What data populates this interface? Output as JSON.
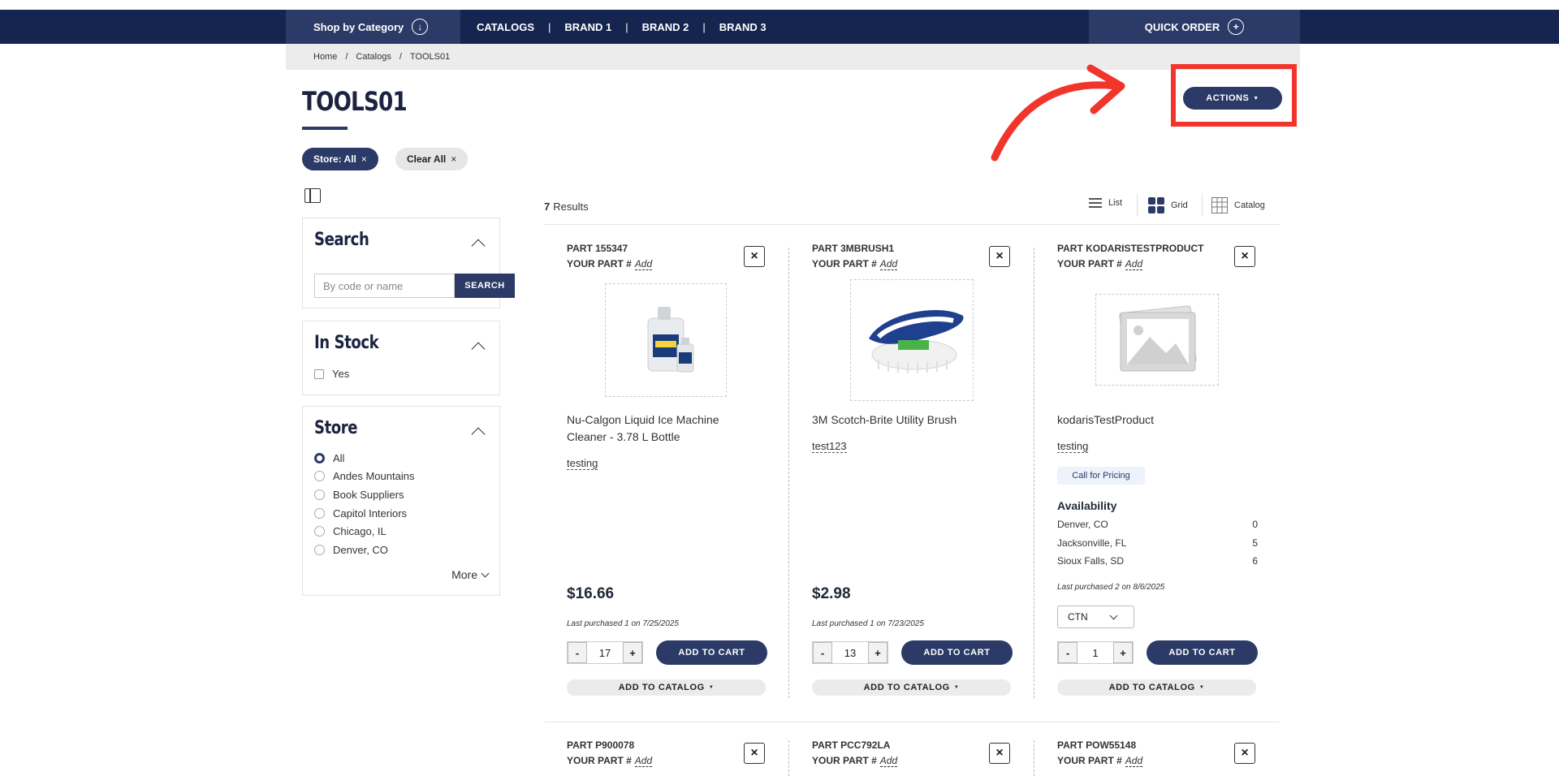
{
  "nav": {
    "shop_by_category": "Shop by Category",
    "links": [
      "CATALOGS",
      "BRAND 1",
      "BRAND 2",
      "BRAND 3"
    ],
    "quick_order": "QUICK ORDER"
  },
  "breadcrumb": [
    "Home",
    "Catalogs",
    "TOOLS01"
  ],
  "page": {
    "title": "TOOLS01",
    "actions_label": "ACTIONS"
  },
  "filters": {
    "store_chip": "Store: All",
    "clear_chip": "Clear All"
  },
  "sidebar": {
    "search": {
      "title": "Search",
      "placeholder": "By code or name",
      "button": "SEARCH"
    },
    "in_stock": {
      "title": "In Stock",
      "option": "Yes"
    },
    "store": {
      "title": "Store",
      "options": [
        "All",
        "Andes Mountains",
        "Book Suppliers",
        "Capitol Interiors",
        "Chicago, IL",
        "Denver, CO"
      ],
      "selected": "All",
      "more": "More"
    }
  },
  "results": {
    "count": "7",
    "label": "Results",
    "views": [
      "List",
      "Grid",
      "Catalog"
    ]
  },
  "common": {
    "your_part": "YOUR PART #",
    "add": "Add",
    "add_to_cart": "ADD TO CART",
    "add_to_catalog": "ADD TO CATALOG"
  },
  "products": [
    {
      "part": "PART 155347",
      "name": "Nu-Calgon Liquid Ice Machine Cleaner - 3.78 L Bottle",
      "tag": "testing",
      "price": "$16.66",
      "last_purchased": "Last purchased 1 on 7/25/2025",
      "qty": "17"
    },
    {
      "part": "PART 3MBRUSH1",
      "name": "3M Scotch-Brite Utility Brush",
      "tag": "test123",
      "price": "$2.98",
      "last_purchased": "Last purchased 1 on 7/23/2025",
      "qty": "13"
    },
    {
      "part": "PART KODARISTESTPRODUCT",
      "name": "kodarisTestProduct",
      "tag": "testing",
      "call_for_pricing": "Call for Pricing",
      "availability_title": "Availability",
      "availability": [
        {
          "loc": "Denver, CO",
          "qty": "0"
        },
        {
          "loc": "Jacksonville, FL",
          "qty": "5"
        },
        {
          "loc": "Sioux Falls, SD",
          "qty": "6"
        }
      ],
      "last_purchased": "Last purchased 2 on 8/6/2025",
      "uom": "CTN",
      "qty": "1"
    }
  ],
  "products_row2": [
    {
      "part": "PART P900078"
    },
    {
      "part": "PART PCC792LA"
    },
    {
      "part": "PART POW55148"
    }
  ],
  "colors": {
    "navy": "#152550",
    "accent": "#2b3a67",
    "highlight": "#f2352b"
  }
}
